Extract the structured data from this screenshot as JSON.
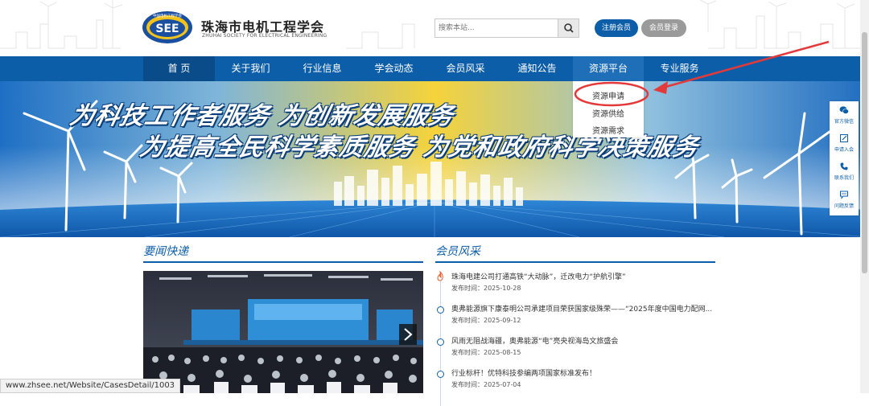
{
  "header": {
    "logo_text": "SEE",
    "logo_ring_text": "中国电机工程学会",
    "site_name": "珠海市电机工程学会",
    "site_name_en": "ZHUHAI SOCIETY FOR ELECTRICAL ENGINEERING",
    "search_placeholder": "搜索本站...",
    "register_label": "注册会员",
    "login_label": "会员登录"
  },
  "nav": {
    "items": [
      "首 页",
      "关于我们",
      "行业信息",
      "学会动态",
      "会员风采",
      "通知公告",
      "资源平台",
      "专业服务"
    ],
    "active": "首 页",
    "open": "资源平台",
    "dropdown": [
      "资源申请",
      "资源供给",
      "资源需求"
    ]
  },
  "banner": {
    "slogan_line1": "为科技工作者服务  为创新发展服务",
    "slogan_line2": "为提高全民科学素质服务  为党和政府科学决策服务"
  },
  "sidebar": {
    "items": [
      "官方微信",
      "申请入会",
      "联系我们",
      "问题反馈"
    ]
  },
  "news": {
    "title": "要闻快递"
  },
  "members": {
    "title": "会员风采",
    "items": [
      {
        "title": "珠海电建公司打通高铁“大动脉”，迁改电力“护航引擎”",
        "date": "发布时间：2025-10-28"
      },
      {
        "title": "奥弗能源旗下康泰明公司承建项目荣获国家级殊荣——“2025年度中国电力配网...",
        "date": "发布时间：2025-09-12"
      },
      {
        "title": "风雨无阻战海疆，奥弗能源“电”亮央视海岛文旅盛会",
        "date": "发布时间：2025-08-15"
      },
      {
        "title": "行业标杆！优特科技参编两项国家标准发布！",
        "date": "发布时间：2025-07-04"
      }
    ]
  },
  "status_bar": {
    "url": "www.zhsee.net/Website/CasesDetail/1003"
  },
  "colors": {
    "brand_blue": "#0d5ea8",
    "annotation_red": "#e23a3a"
  }
}
